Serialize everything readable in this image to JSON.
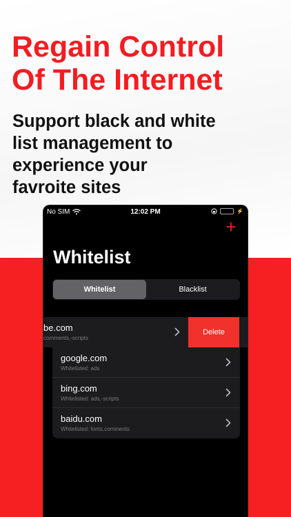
{
  "headline": {
    "line1": "Regain Control",
    "line2": "Of The Internet"
  },
  "subhead": {
    "line1": "Support black and white",
    "line2": "list management to",
    "line3": "experience your",
    "line4": "favroite sites"
  },
  "status_bar": {
    "carrier": "No SIM",
    "time": "12:02 PM"
  },
  "header": {
    "title": "Whitelist",
    "add_icon": "plus-icon"
  },
  "segmented_control": {
    "options": [
      "Whitelist",
      "Blacklist"
    ],
    "selected": "Whitelist"
  },
  "swiped_row": {
    "domain": "be.com",
    "detail": "comments,-scripts",
    "action": "Delete"
  },
  "rows": [
    {
      "domain": "google.com",
      "detail": "Whitelisted: ads"
    },
    {
      "domain": "bing.com",
      "detail": "Whitelisted: ads,-scripts"
    },
    {
      "domain": "baidu.com",
      "detail": "Whitelisted: fonts,comments"
    }
  ],
  "colors": {
    "brand_red": "#f31d21",
    "delete_red": "#f0312c",
    "battery_green": "#34c759"
  }
}
